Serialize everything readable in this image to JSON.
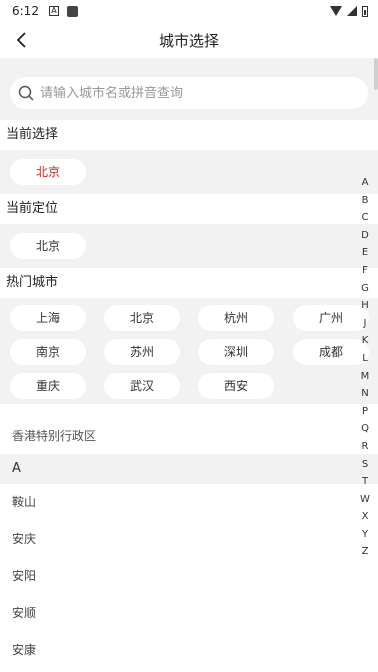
{
  "status_bar": {
    "time": "6:12",
    "icon_a": "A"
  },
  "header": {
    "title": "城市选择"
  },
  "search": {
    "placeholder": "请输入城市名或拼音查询",
    "value": ""
  },
  "current_selection": {
    "label": "当前选择",
    "city": "北京"
  },
  "current_location": {
    "label": "当前定位",
    "city": "北京"
  },
  "hot_cities": {
    "label": "热门城市",
    "cities": [
      "上海",
      "北京",
      "杭州",
      "广州",
      "南京",
      "苏州",
      "深圳",
      "成都",
      "重庆",
      "武汉",
      "西安"
    ]
  },
  "region_row": "香港特别行政区",
  "groups": [
    {
      "letter": "A",
      "cities": [
        "鞍山",
        "安庆",
        "安阳",
        "安顺",
        "安康"
      ]
    }
  ],
  "index_letters": [
    "A",
    "B",
    "C",
    "D",
    "E",
    "F",
    "G",
    "H",
    "J",
    "K",
    "L",
    "M",
    "N",
    "P",
    "Q",
    "R",
    "S",
    "T",
    "W",
    "X",
    "Y",
    "Z"
  ],
  "colors": {
    "selected_text": "#c4262c",
    "section_bg": "#f2f2f2"
  }
}
